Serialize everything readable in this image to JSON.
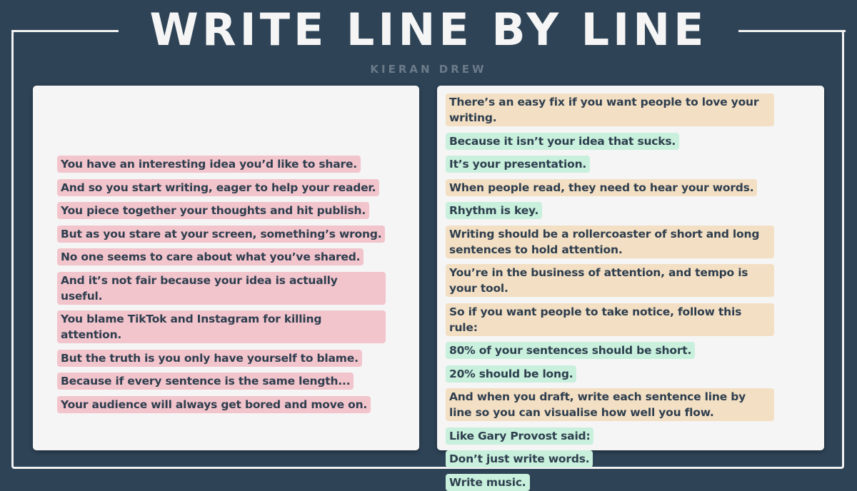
{
  "header": {
    "title": "WRITE LINE BY LINE",
    "author": "KIERAN DREW"
  },
  "colors": {
    "background": "#2e4356",
    "panel": "#f5f5f5",
    "text": "#2e3e4e",
    "pink": "#f2c4cc",
    "tan": "#f3dfc3",
    "green": "#c8f0dc"
  },
  "left_panel": {
    "lines": [
      {
        "text": "You have an interesting idea you’d like to share.",
        "color": "pink"
      },
      {
        "text": "And so you start writing, eager to help your reader.",
        "color": "pink"
      },
      {
        "text": "You piece together your thoughts and hit publish.",
        "color": "pink"
      },
      {
        "text": "But as you stare at your screen, something’s wrong.",
        "color": "pink"
      },
      {
        "text": "No one seems to care about what you’ve shared.",
        "color": "pink"
      },
      {
        "text": "And it’s not fair because your idea is actually useful.",
        "color": "pink"
      },
      {
        "text": "You blame TikTok and Instagram for killing attention.",
        "color": "pink"
      },
      {
        "text": "But the truth is you only have yourself to blame.",
        "color": "pink"
      },
      {
        "text": "Because if every sentence is the same length...",
        "color": "pink"
      },
      {
        "text": "Your audience will always get bored and move on.",
        "color": "pink"
      }
    ]
  },
  "right_panel": {
    "lines": [
      {
        "text": "There’s an easy fix if you want people to love your writing.",
        "color": "tan"
      },
      {
        "text": "Because it isn’t your idea that sucks.",
        "color": "green"
      },
      {
        "text": "It’s your presentation.",
        "color": "green"
      },
      {
        "text": "When people read, they need to hear your words.",
        "color": "tan"
      },
      {
        "text": "Rhythm is key.",
        "color": "green"
      },
      {
        "text": "Writing should be a rollercoaster of short and long sentences to hold attention.",
        "color": "tan"
      },
      {
        "text": "You’re in the business of attention, and tempo is your tool.",
        "color": "tan"
      },
      {
        "text": "So if you want people to take notice, follow this rule:",
        "color": "tan"
      },
      {
        "text": "80% of your sentences should be short.",
        "color": "green"
      },
      {
        "text": "20% should be long.",
        "color": "green"
      },
      {
        "text": "And when you draft, write each sentence line by line so you can visualise how well you flow.",
        "color": "tan"
      },
      {
        "text": "Like Gary Provost said:",
        "color": "green"
      },
      {
        "text": "Don’t just write words.",
        "color": "green"
      },
      {
        "text": "Write music.",
        "color": "green"
      }
    ]
  }
}
